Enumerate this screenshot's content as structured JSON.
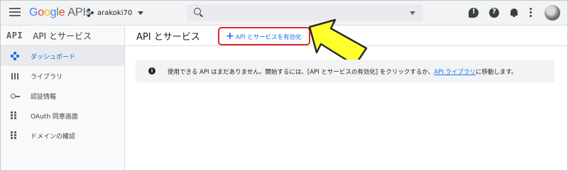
{
  "topbar": {
    "logo_google": [
      "G",
      "o",
      "o",
      "g",
      "l",
      "e"
    ],
    "logo_apis": "APIs",
    "project_name": "arakoki70",
    "search_placeholder": ""
  },
  "sidebar": {
    "logo_text": "API",
    "title": "API とサービス",
    "items": [
      {
        "label": "ダッシュボード",
        "icon": "dashboard-icon",
        "active": true
      },
      {
        "label": "ライブラリ",
        "icon": "library-icon",
        "active": false
      },
      {
        "label": "認証情報",
        "icon": "key-icon",
        "active": false
      },
      {
        "label": "OAuth 同意画面",
        "icon": "consent-screen-icon",
        "active": false
      },
      {
        "label": "ドメインの確認",
        "icon": "domain-verification-icon",
        "active": false
      }
    ]
  },
  "main": {
    "title": "API とサービス",
    "enable_button_label": "API とサービスを有効化",
    "info": {
      "text_before": "使用できる API はまだありません。開始するには、[API とサービスの有効化] をクリックするか、",
      "link": "API ライブラリ",
      "text_after": "に移動します。"
    }
  },
  "colors": {
    "accent": "#1a73e8",
    "highlight_border": "#e0282b",
    "arrow_fill": "#ffff2e"
  }
}
